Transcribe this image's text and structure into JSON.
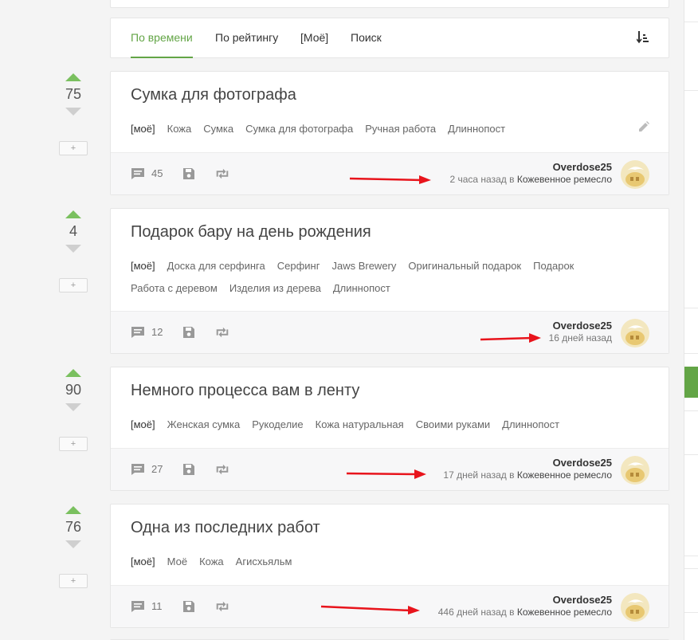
{
  "tabs": [
    {
      "label": "По времени",
      "active": true
    },
    {
      "label": "По рейтингу"
    },
    {
      "label": "[Моё]"
    },
    {
      "label": "Поиск"
    }
  ],
  "posts": [
    {
      "score": "75",
      "title": "Сумка для фотографа",
      "tags": [
        "[моё]",
        "Кожа",
        "Сумка",
        "Сумка для фотографа",
        "Ручная работа",
        "Длиннопост"
      ],
      "comments": "45",
      "author": "Overdose25",
      "time": "2 часа назад",
      "in_word": "в",
      "community": "Кожевенное ремесло"
    },
    {
      "score": "4",
      "title": "Подарок бару на день рождения",
      "tags": [
        "[моё]",
        "Доска для серфинга",
        "Серфинг",
        "Jaws Brewery",
        "Оригинальный подарок",
        "Подарок",
        "Работа с деревом",
        "Изделия из дерева",
        "Длиннопост"
      ],
      "comments": "12",
      "author": "Overdose25",
      "time": "16 дней назад",
      "in_word": "",
      "community": ""
    },
    {
      "score": "90",
      "title": "Немного процесса вам в ленту",
      "tags": [
        "[моё]",
        "Женская сумка",
        "Рукоделие",
        "Кожа натуральная",
        "Своими руками",
        "Длиннопост"
      ],
      "comments": "27",
      "author": "Overdose25",
      "time": "17 дней назад",
      "in_word": "в",
      "community": "Кожевенное ремесло"
    },
    {
      "score": "76",
      "title": "Одна из последних работ",
      "tags": [
        "[моё]",
        "Моё",
        "Кожа",
        "Агисхьяльм"
      ],
      "comments": "11",
      "author": "Overdose25",
      "time": "446 дней назад",
      "in_word": "в",
      "community": "Кожевенное ремесло"
    }
  ],
  "plus_label": "+",
  "colors": {
    "accent": "#63a546",
    "upvote": "#7ac05f",
    "annotation_arrow": "#e8141c"
  },
  "icons": {
    "comments": "comment-icon",
    "save": "save-icon",
    "share": "repost-icon",
    "sort": "sort-icon",
    "edit": "pencil-icon"
  }
}
